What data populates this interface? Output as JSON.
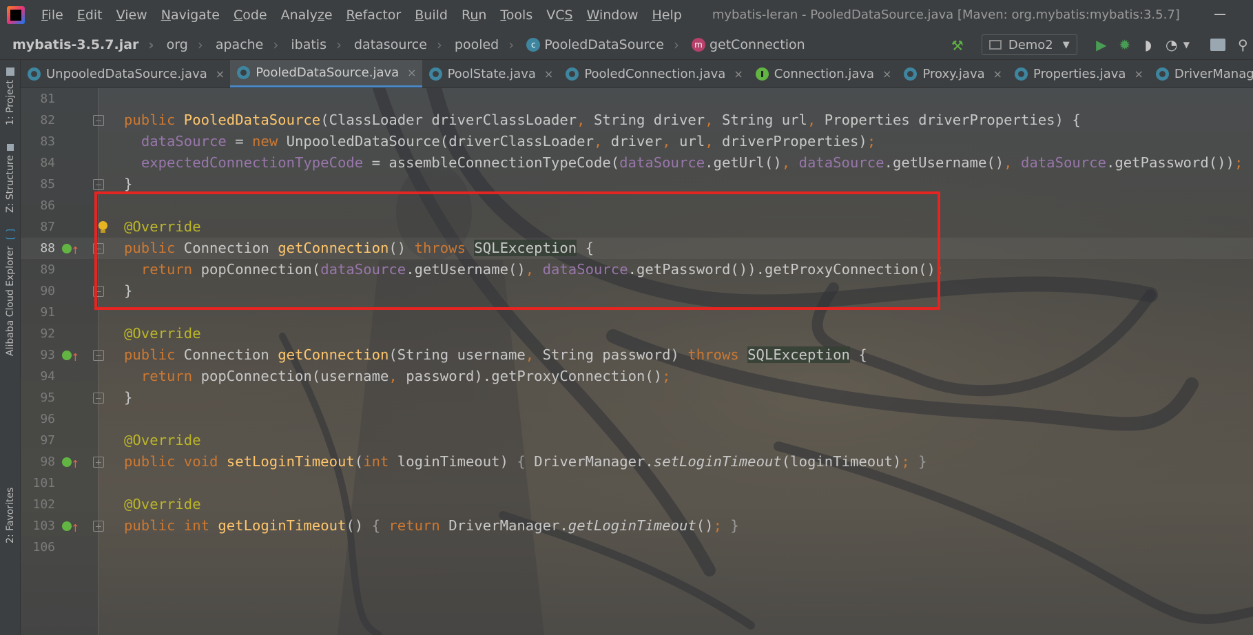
{
  "menubar": {
    "items": [
      {
        "pre": "",
        "u": "F",
        "post": "ile"
      },
      {
        "pre": "",
        "u": "E",
        "post": "dit"
      },
      {
        "pre": "",
        "u": "V",
        "post": "iew"
      },
      {
        "pre": "",
        "u": "N",
        "post": "avigate"
      },
      {
        "pre": "",
        "u": "C",
        "post": "ode"
      },
      {
        "pre": "Analy",
        "u": "z",
        "post": "e"
      },
      {
        "pre": "",
        "u": "R",
        "post": "efactor"
      },
      {
        "pre": "",
        "u": "B",
        "post": "uild"
      },
      {
        "pre": "R",
        "u": "u",
        "post": "n"
      },
      {
        "pre": "",
        "u": "T",
        "post": "ools"
      },
      {
        "pre": "VC",
        "u": "S",
        "post": ""
      },
      {
        "pre": "",
        "u": "W",
        "post": "indow"
      },
      {
        "pre": "",
        "u": "H",
        "post": "elp"
      }
    ],
    "window_title": "mybatis-leran - PooledDataSource.java [Maven: org.mybatis:mybatis:3.5.7]"
  },
  "navbar": {
    "crumbs": [
      "mybatis-3.5.7.jar",
      "org",
      "apache",
      "ibatis",
      "datasource",
      "pooled"
    ],
    "class_crumb": "PooledDataSource",
    "class_badge": "c",
    "method_crumb": "getConnection",
    "method_badge": "m",
    "run_config": "Demo2"
  },
  "tool_strip": {
    "project": "1: Project",
    "structure": "Z: Structure",
    "cloud": "Alibaba Cloud Explorer",
    "favorites": "2: Favorites"
  },
  "tabs": [
    {
      "label": "UnpooledDataSource.java",
      "kind": "class",
      "active": false
    },
    {
      "label": "PooledDataSource.java",
      "kind": "class",
      "active": true
    },
    {
      "label": "PoolState.java",
      "kind": "class",
      "active": false
    },
    {
      "label": "PooledConnection.java",
      "kind": "class",
      "active": false
    },
    {
      "label": "Connection.java",
      "kind": "interface",
      "active": false
    },
    {
      "label": "Proxy.java",
      "kind": "class",
      "active": false
    },
    {
      "label": "Properties.java",
      "kind": "class",
      "active": false
    },
    {
      "label": "DriverManager.java",
      "kind": "class",
      "active": false
    }
  ],
  "editor": {
    "current_line": "88",
    "lines": [
      {
        "n": "81",
        "segs": []
      },
      {
        "n": "82",
        "gut": "fold",
        "segs": [
          {
            "t": "public ",
            "c": "kw"
          },
          {
            "t": "PooledDataSource",
            "c": "fn"
          },
          {
            "t": "(ClassLoader driverClassLoader"
          },
          {
            "t": ", ",
            "c": "kw"
          },
          {
            "t": "String driver"
          },
          {
            "t": ", ",
            "c": "kw"
          },
          {
            "t": "String url"
          },
          {
            "t": ", ",
            "c": "kw"
          },
          {
            "t": "Properties driverProperties) {"
          }
        ]
      },
      {
        "n": "83",
        "segs": [
          {
            "t": "  "
          },
          {
            "t": "dataSource",
            "c": "fld"
          },
          {
            "t": " = "
          },
          {
            "t": "new ",
            "c": "kw"
          },
          {
            "t": "UnpooledDataSource(driverClassLoader"
          },
          {
            "t": ", ",
            "c": "kw"
          },
          {
            "t": "driver"
          },
          {
            "t": ", ",
            "c": "kw"
          },
          {
            "t": "url"
          },
          {
            "t": ", ",
            "c": "kw"
          },
          {
            "t": "driverProperties)"
          },
          {
            "t": ";",
            "c": "kw"
          }
        ]
      },
      {
        "n": "84",
        "segs": [
          {
            "t": "  "
          },
          {
            "t": "expectedConnectionTypeCode",
            "c": "fld"
          },
          {
            "t": " = assembleConnectionTypeCode("
          },
          {
            "t": "dataSource",
            "c": "fld"
          },
          {
            "t": ".getUrl()"
          },
          {
            "t": ", ",
            "c": "kw"
          },
          {
            "t": "dataSource",
            "c": "fld"
          },
          {
            "t": ".getUsername()"
          },
          {
            "t": ", ",
            "c": "kw"
          },
          {
            "t": "dataSource",
            "c": "fld"
          },
          {
            "t": ".getPassword())"
          },
          {
            "t": ";",
            "c": "kw"
          }
        ]
      },
      {
        "n": "85",
        "gut": "fold",
        "segs": [
          {
            "t": "}"
          }
        ]
      },
      {
        "n": "86",
        "segs": []
      },
      {
        "n": "87",
        "gut": "bulb",
        "segs": [
          {
            "t": "@Override",
            "c": "ann"
          }
        ]
      },
      {
        "n": "88",
        "gut": "impl-fold",
        "segs": [
          {
            "t": "public ",
            "c": "kw"
          },
          {
            "t": "Connection "
          },
          {
            "t": "getConnection",
            "c": "fn"
          },
          {
            "t": "() "
          },
          {
            "t": "throws ",
            "c": "kw"
          },
          {
            "t": "SQLException",
            "c": "hl"
          },
          {
            "t": " {"
          }
        ]
      },
      {
        "n": "89",
        "segs": [
          {
            "t": "  "
          },
          {
            "t": "return ",
            "c": "kw"
          },
          {
            "t": "popConnection("
          },
          {
            "t": "dataSource",
            "c": "fld"
          },
          {
            "t": ".getUsername()"
          },
          {
            "t": ", ",
            "c": "kw"
          },
          {
            "t": "dataSource",
            "c": "fld"
          },
          {
            "t": ".getPassword()).getProxyConnection()"
          },
          {
            "t": ";",
            "c": "kw"
          }
        ]
      },
      {
        "n": "90",
        "gut": "fold",
        "segs": [
          {
            "t": "}"
          }
        ]
      },
      {
        "n": "91",
        "segs": []
      },
      {
        "n": "92",
        "segs": [
          {
            "t": "@Override",
            "c": "ann"
          }
        ]
      },
      {
        "n": "93",
        "gut": "impl-fold",
        "segs": [
          {
            "t": "public ",
            "c": "kw"
          },
          {
            "t": "Connection "
          },
          {
            "t": "getConnection",
            "c": "fn"
          },
          {
            "t": "(String username"
          },
          {
            "t": ", ",
            "c": "kw"
          },
          {
            "t": "String password) "
          },
          {
            "t": "throws ",
            "c": "kw"
          },
          {
            "t": "SQLException",
            "c": "hl"
          },
          {
            "t": " {"
          }
        ]
      },
      {
        "n": "94",
        "segs": [
          {
            "t": "  "
          },
          {
            "t": "return ",
            "c": "kw"
          },
          {
            "t": "popConnection(username"
          },
          {
            "t": ", ",
            "c": "kw"
          },
          {
            "t": "password).getProxyConnection()"
          },
          {
            "t": ";",
            "c": "kw"
          }
        ]
      },
      {
        "n": "95",
        "gut": "fold",
        "segs": [
          {
            "t": "}"
          }
        ]
      },
      {
        "n": "96",
        "segs": []
      },
      {
        "n": "97",
        "segs": [
          {
            "t": "@Override",
            "c": "ann"
          }
        ]
      },
      {
        "n": "98",
        "gut": "impl-expand",
        "segs": [
          {
            "t": "public ",
            "c": "kw"
          },
          {
            "t": "void ",
            "c": "kw"
          },
          {
            "t": "setLoginTimeout",
            "c": "fn"
          },
          {
            "t": "("
          },
          {
            "t": "int ",
            "c": "kw"
          },
          {
            "t": "loginTimeout) "
          },
          {
            "t": "{ ",
            "c": "dim"
          },
          {
            "t": "DriverManager."
          },
          {
            "t": "setLoginTimeout",
            "c": "stm"
          },
          {
            "t": "(loginTimeout)"
          },
          {
            "t": ";",
            "c": "kw"
          },
          {
            "t": " }",
            "c": "dim"
          }
        ]
      },
      {
        "n": "101",
        "segs": []
      },
      {
        "n": "102",
        "segs": [
          {
            "t": "@Override",
            "c": "ann"
          }
        ]
      },
      {
        "n": "103",
        "gut": "impl-expand",
        "segs": [
          {
            "t": "public ",
            "c": "kw"
          },
          {
            "t": "int ",
            "c": "kw"
          },
          {
            "t": "getLoginTimeout",
            "c": "fn"
          },
          {
            "t": "() "
          },
          {
            "t": "{ ",
            "c": "dim"
          },
          {
            "t": "return ",
            "c": "kw"
          },
          {
            "t": "DriverManager."
          },
          {
            "t": "getLoginTimeout",
            "c": "stm"
          },
          {
            "t": "()"
          },
          {
            "t": ";",
            "c": "kw"
          },
          {
            "t": " }",
            "c": "dim"
          }
        ]
      },
      {
        "n": "106",
        "segs": []
      }
    ]
  },
  "colors": {
    "highlight_box": "#e42521",
    "keyword": "#cc7832",
    "annotation": "#bbb529",
    "method": "#ffc66d",
    "field": "#9876aa"
  }
}
